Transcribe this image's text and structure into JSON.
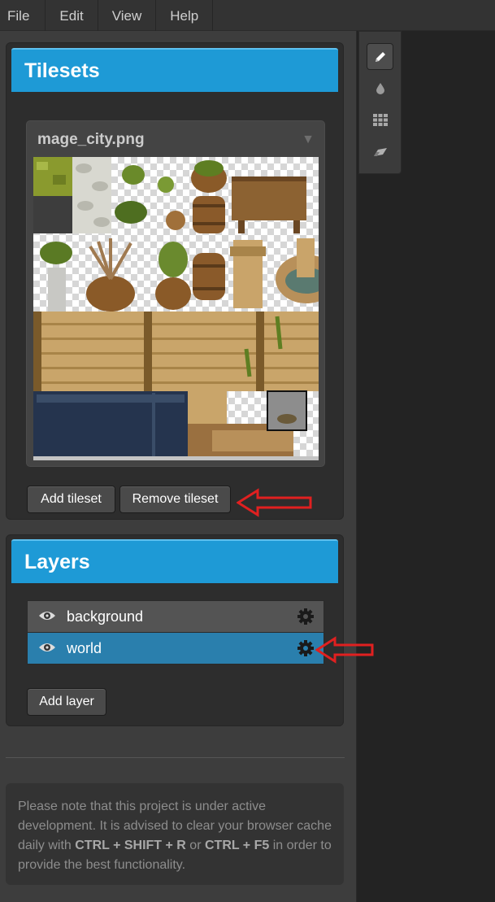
{
  "menu": {
    "items": [
      "File",
      "Edit",
      "View",
      "Help"
    ]
  },
  "tilesets": {
    "title": "Tilesets",
    "selected": "mage_city.png",
    "add_label": "Add tileset",
    "remove_label": "Remove tileset"
  },
  "layers": {
    "title": "Layers",
    "items": [
      {
        "name": "background",
        "selected": false
      },
      {
        "name": "world",
        "selected": true
      }
    ],
    "add_label": "Add layer"
  },
  "notice": {
    "text_1": "Please note that this project is under active development. It is advised to clear your browser cache daily with ",
    "key_1": "CTRL + SHIFT + R",
    "text_2": " or ",
    "key_2": "CTRL + F5",
    "text_3": " in order to provide the best functionality."
  },
  "tools": [
    {
      "icon": "pencil-icon",
      "active": true
    },
    {
      "icon": "fill-drop-icon",
      "active": false
    },
    {
      "icon": "grid-icon",
      "active": false
    },
    {
      "icon": "eraser-icon",
      "active": false
    }
  ],
  "colors": {
    "accent": "#1e9ad6",
    "selected_layer": "#2a7fad",
    "annotation_arrow": "#e02020"
  }
}
